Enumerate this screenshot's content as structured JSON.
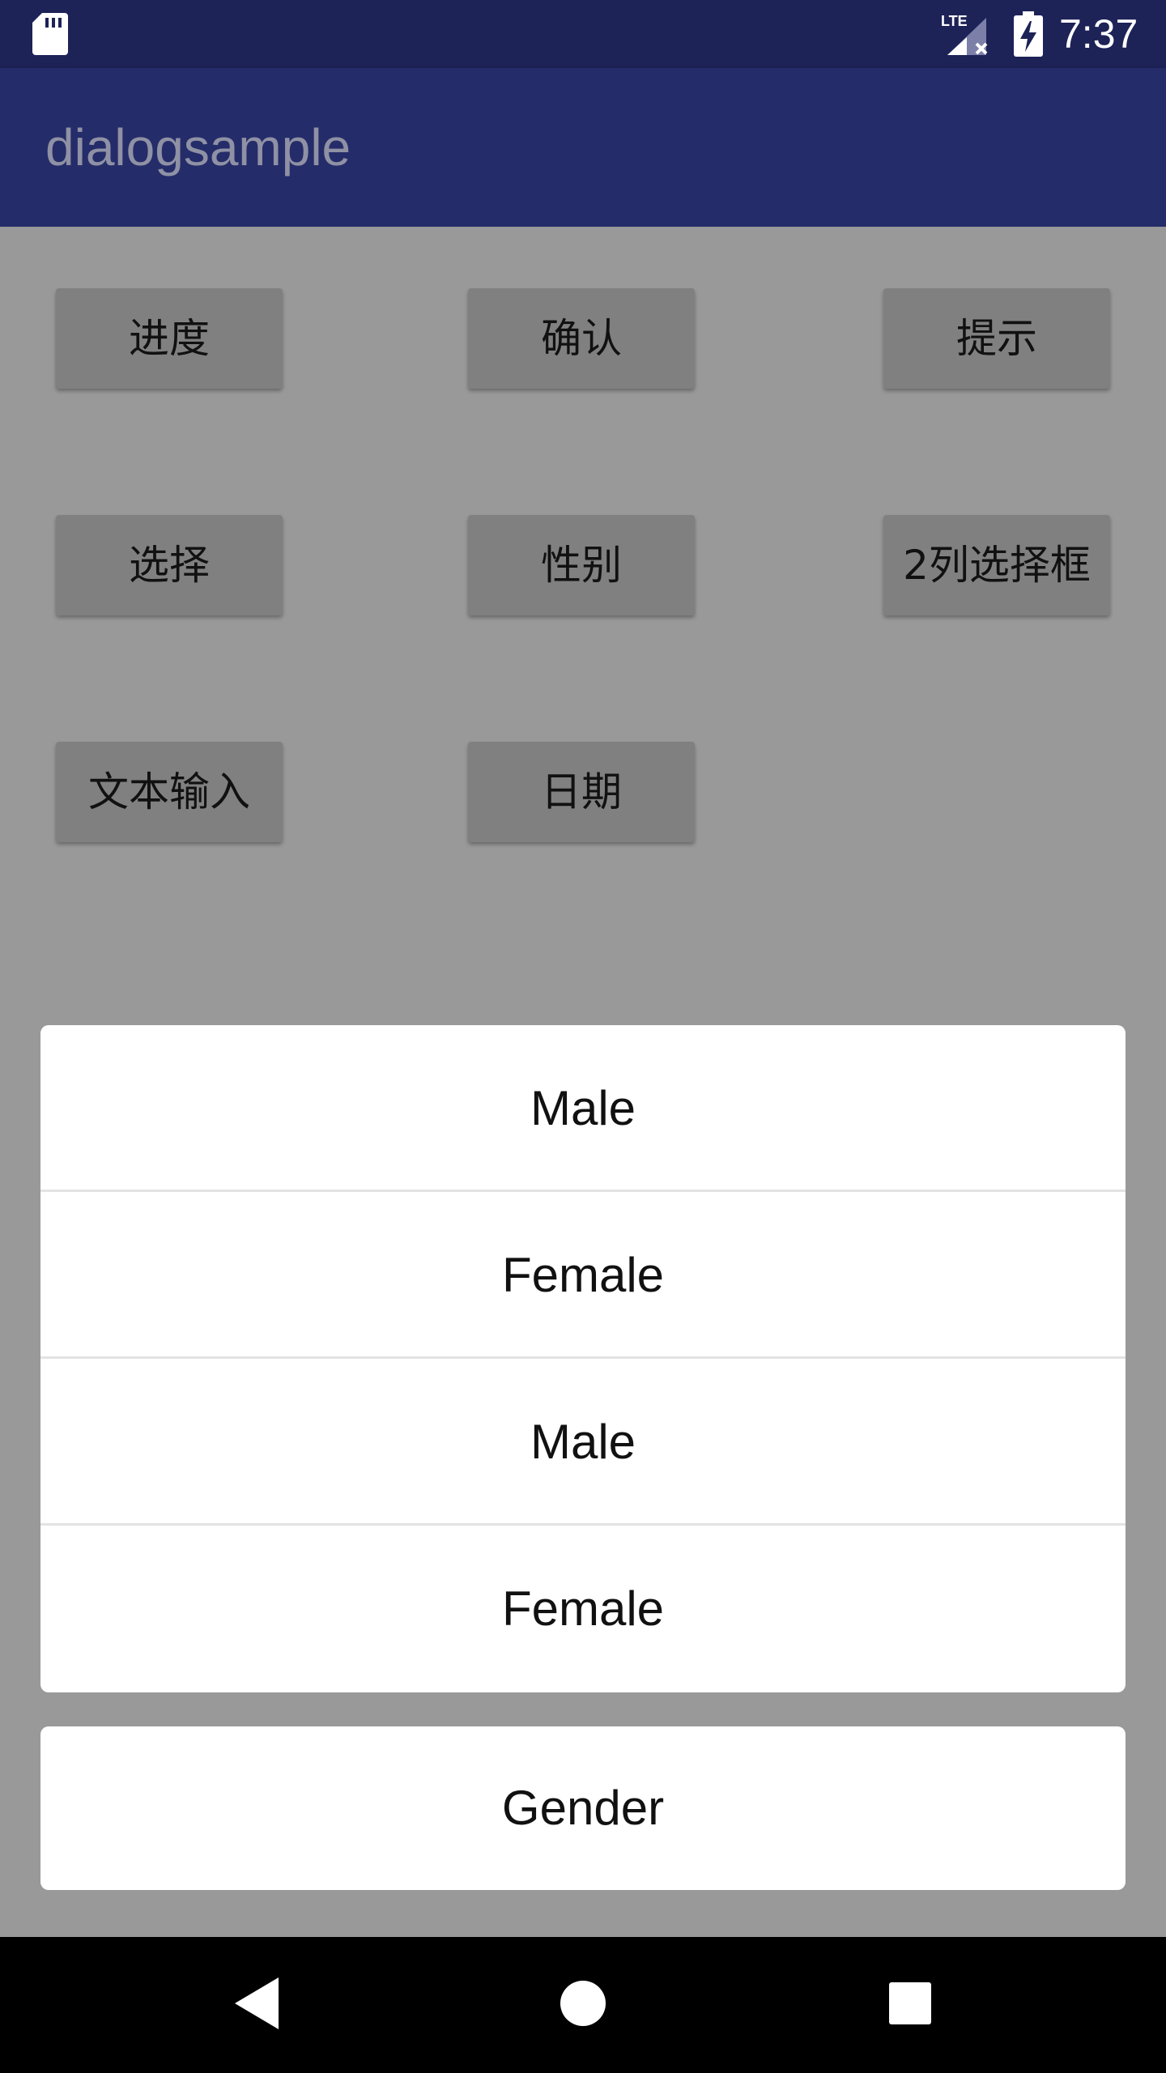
{
  "status_bar": {
    "time": "7:37",
    "network_label": "LTE",
    "icons": [
      "sd-card-icon",
      "lte-signal-icon",
      "battery-charging-icon"
    ]
  },
  "app_bar": {
    "title": "dialogsample"
  },
  "buttons": [
    {
      "label": "进度"
    },
    {
      "label": "确认"
    },
    {
      "label": "提示"
    },
    {
      "label": "选择"
    },
    {
      "label": "性别"
    },
    {
      "label": "2列选择框"
    },
    {
      "label": "文本输入"
    },
    {
      "label": "日期"
    }
  ],
  "action_sheet": {
    "options": [
      {
        "label": "Male"
      },
      {
        "label": "Female"
      },
      {
        "label": "Male"
      },
      {
        "label": "Female"
      }
    ],
    "cancel_label": "Gender"
  },
  "nav_bar": {
    "icons": [
      "back-icon",
      "home-icon",
      "recents-icon"
    ]
  },
  "colors": {
    "status_bar": "#1d2257",
    "app_bar": "#252c6a",
    "scrim_background": "#999999",
    "button": "#7f807f",
    "sheet": "#ffffff",
    "nav_bar": "#000000"
  }
}
